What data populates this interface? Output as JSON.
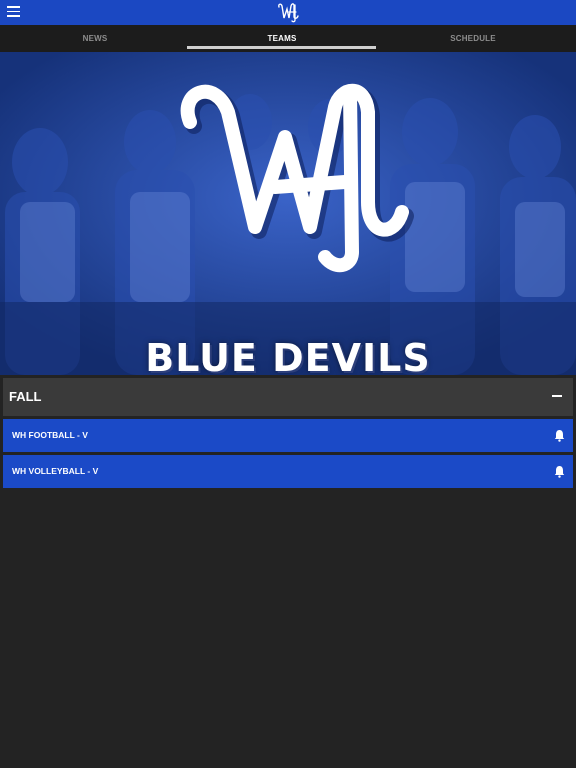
{
  "header": {
    "menu_icon": "hamburger-menu-icon",
    "logo_text": "WH"
  },
  "tabs": [
    {
      "label": "NEWS",
      "active": false
    },
    {
      "label": "TEAMS",
      "active": true
    },
    {
      "label": "SCHEDULE",
      "active": false
    }
  ],
  "hero": {
    "logo_text": "WH",
    "title": "BLUE DEVILS"
  },
  "season": {
    "label": "FALL",
    "icon": "collapse-minus-icon"
  },
  "teams": [
    {
      "label": "WH FOOTBALL - V",
      "icon": "bell-icon"
    },
    {
      "label": "WH VOLLEYBALL - V",
      "icon": "bell-icon"
    }
  ],
  "colors": {
    "accent_blue": "#1b48c2",
    "team_row_blue": "#1b4ac7",
    "background": "#232323",
    "tab_bar": "#1c1c1c",
    "season_header": "#3a3a3a"
  }
}
